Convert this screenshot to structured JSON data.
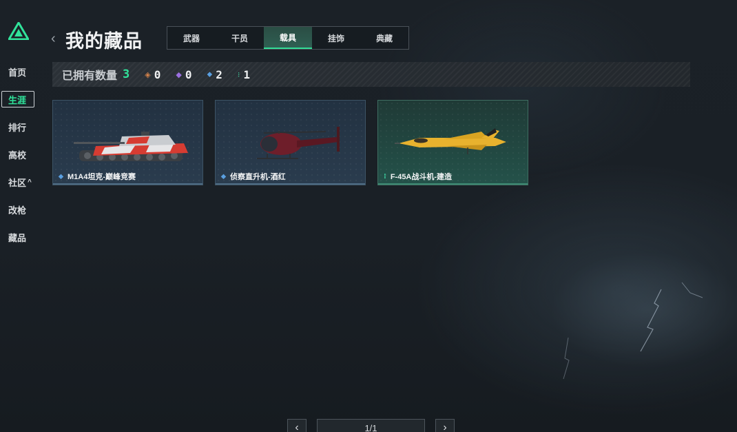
{
  "sidebar": {
    "items": [
      {
        "label": "首页"
      },
      {
        "label": "生涯"
      },
      {
        "label": "排行"
      },
      {
        "label": "高校"
      },
      {
        "label": "社区"
      },
      {
        "label": "改枪"
      },
      {
        "label": "藏品"
      }
    ],
    "active": "生涯",
    "community_caret": "^"
  },
  "header": {
    "back": "‹",
    "title": "我的藏品"
  },
  "tabs": [
    {
      "label": "武器"
    },
    {
      "label": "干员"
    },
    {
      "label": "载具"
    },
    {
      "label": "挂饰"
    },
    {
      "label": "典藏"
    }
  ],
  "active_tab": "载具",
  "stats": {
    "label": "已拥有数量",
    "total": "3",
    "counts": [
      {
        "value": "0",
        "color": "#d6834a",
        "icon": "orange-diamond-icon"
      },
      {
        "value": "0",
        "color": "#9b6fe0",
        "icon": "purple-diamond-icon"
      },
      {
        "value": "2",
        "color": "#5a9fe0",
        "icon": "blue-diamond-icon"
      },
      {
        "value": "1",
        "color": "#3bc79a",
        "icon": "green-diamond-icon"
      }
    ]
  },
  "cards": [
    {
      "name": "M1A4坦克-巅峰竞赛",
      "rarity": "blue",
      "rarity_color": "#5a9fe0",
      "image": "tank-image"
    },
    {
      "name": "侦察直升机-酒红",
      "rarity": "blue",
      "rarity_color": "#5a9fe0",
      "image": "helicopter-image"
    },
    {
      "name": "F-45A战斗机-建造",
      "rarity": "green",
      "rarity_color": "#3bc79a",
      "image": "jet-image"
    }
  ],
  "pager": {
    "prev": "‹",
    "page": "1/1",
    "next": "›"
  },
  "colors": {
    "accent": "#31e39b"
  }
}
